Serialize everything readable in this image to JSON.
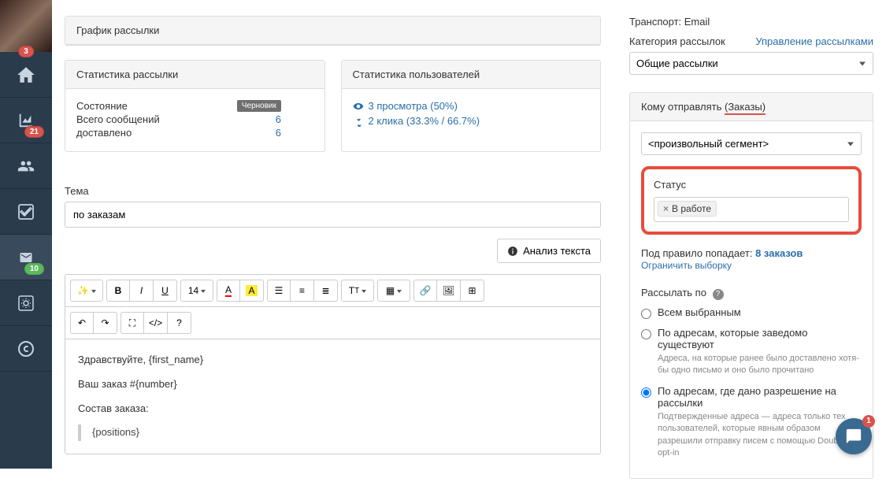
{
  "sidebar": {
    "badge_top": "3",
    "badge_chart": "21",
    "badge_mail": "10"
  },
  "panels": {
    "chart_title": "График рассылки",
    "stats_title": "Статистика рассылки",
    "userstats_title": "Статистика пользователей"
  },
  "stats": {
    "state_label": "Состояние",
    "state_value": "Черновик",
    "total_label": "Всего сообщений",
    "total_value": "6",
    "delivered_label": "доставлено",
    "delivered_value": "6"
  },
  "userstats": {
    "views": "3 просмотра (50%)",
    "clicks": "2 клика (33.3% / 66.7%)"
  },
  "topic": {
    "label": "Тема",
    "value": "по заказам"
  },
  "analyze_btn": "Анализ текста",
  "editor": {
    "line1": "Здравствуйте, {first_name}",
    "line2": "Ваш заказ #{number}",
    "line3": "Состав заказа:",
    "quote": "{positions}"
  },
  "right": {
    "transport_label": "Транспорт:",
    "transport_value": "Email",
    "category_label": "Категория рассылок",
    "manage_link": "Управление рассылками",
    "category_value": "Общие рассылки",
    "recipients_prefix": "Кому отправлять",
    "recipients_suffix": "(Заказы)",
    "segment_value": "<произвольный сегмент>",
    "status_label": "Статус",
    "status_chip": "В работе",
    "rule_prefix": "Под правило попадает:",
    "rule_count": "8 заказов",
    "limit_link": "Ограничить выборку",
    "send_by_label": "Рассылать по",
    "radio1": "Всем выбранным",
    "radio2": "По адресам, которые заведомо существуют",
    "radio2_sub": "Адреса, на которые ранее было доставлено хотя-бы одно письмо и оно было прочитано",
    "radio3": "По адресам, где дано разрешение на рассылки",
    "radio3_sub": "Подтвержденные адреса — адреса только тех пользователей, которые явным образом разрешили отправку писем с помощью Double-opt-in"
  },
  "fab_badge": "1"
}
